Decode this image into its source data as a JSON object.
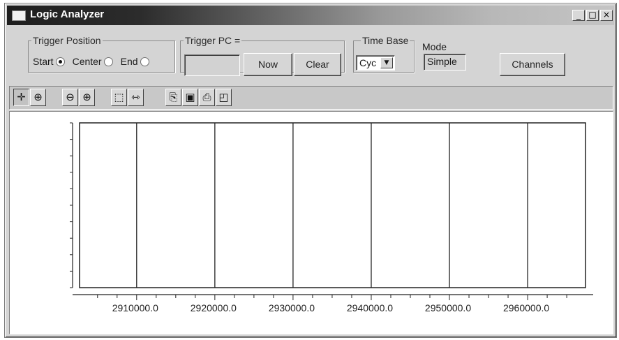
{
  "window": {
    "title": "Logic Analyzer",
    "controls": {
      "minimize": "_",
      "maximize": "□",
      "close": "×"
    }
  },
  "trigger_position": {
    "label": "Trigger Position",
    "options": [
      {
        "label": "Start",
        "checked": true
      },
      {
        "label": "Center",
        "checked": false
      },
      {
        "label": "End",
        "checked": false
      }
    ]
  },
  "trigger_pc": {
    "label": "Trigger PC =",
    "value": "",
    "now_label": "Now",
    "clear_label": "Clear"
  },
  "time_base": {
    "label": "Time Base",
    "selected": "Cyc"
  },
  "mode": {
    "label": "Mode",
    "value": "Simple"
  },
  "channels_label": "Channels",
  "toolbar": {
    "buttons": [
      {
        "name": "pan-icon",
        "glyph": "✛",
        "pressed": true
      },
      {
        "name": "zoom-region-icon",
        "glyph": "⊕"
      },
      {
        "name": "zoom-out-icon",
        "glyph": "⊖"
      },
      {
        "name": "zoom-in-icon",
        "glyph": "⊕"
      },
      {
        "name": "select-region-icon",
        "glyph": "⬚"
      },
      {
        "name": "fit-icon",
        "glyph": "⇿"
      },
      {
        "name": "copy-icon",
        "glyph": "⎘"
      },
      {
        "name": "save-icon",
        "glyph": "▣"
      },
      {
        "name": "print-icon",
        "glyph": "⎙"
      },
      {
        "name": "print-preview-icon",
        "glyph": "◰"
      }
    ]
  },
  "chart_data": {
    "type": "line",
    "title": "",
    "xlabel": "",
    "ylabel": "",
    "x_tick_labels": [
      "2910000.0",
      "2920000.0",
      "2930000.0",
      "2940000.0",
      "2950000.0",
      "2960000.0"
    ],
    "x_ticks": [
      2910000,
      2920000,
      2930000,
      2940000,
      2950000,
      2960000
    ],
    "xlim": [
      2902700,
      2967400
    ],
    "grid": "vertical",
    "series": []
  }
}
